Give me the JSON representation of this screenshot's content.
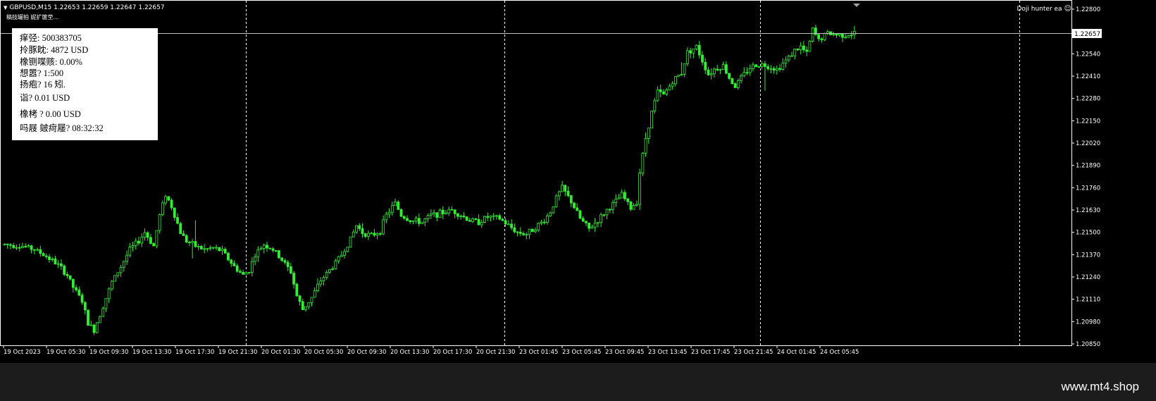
{
  "chart_header": {
    "symbol_line": "GBPUSD,M15  1.22653 1.22659 1.22647 1.22657",
    "sub_line": "稿技罐拍 妮扩箧茔...",
    "ea_name": "Doji hunter ea",
    "collapse_icon": "triangle-down",
    "smiley_icon": "smiley-face"
  },
  "info_panel": {
    "account": "痒弪: 500383705",
    "balance": "拎豚眈: 4872 USD",
    "drawdown": "橡铡喋赅: 0.00%",
    "leverage": "想嚣? 1:500",
    "spread": "扬疱? 16 矧.",
    "lot": "诣? 0.01 USD",
    "profit": "橡栲    ? 0.00 USD",
    "time": "吗屐     皴疴屦? 08:32:32"
  },
  "current_price": "1.22657",
  "watermark": "www.mt4.shop",
  "colors": {
    "candle": "#33ee33",
    "background": "#000000",
    "grid": "#ffffff"
  },
  "chart_data": {
    "type": "candlestick",
    "symbol": "GBPUSD",
    "timeframe": "M15",
    "ylim": [
      1.2085,
      1.2285
    ],
    "y_ticks": [
      "1.22800",
      "1.22670",
      "1.22540",
      "1.22410",
      "1.22280",
      "1.22150",
      "1.22020",
      "1.21890",
      "1.21760",
      "1.21630",
      "1.21500",
      "1.21370",
      "1.21240",
      "1.21110",
      "1.20980",
      "1.20850"
    ],
    "x_ticks": [
      "19 Oct 2023",
      "19 Oct 05:30",
      "19 Oct 09:30",
      "19 Oct 13:30",
      "19 Oct 17:30",
      "19 Oct 21:30",
      "20 Oct 01:30",
      "20 Oct 05:30",
      "20 Oct 09:30",
      "20 Oct 13:30",
      "20 Oct 17:30",
      "20 Oct 21:30",
      "23 Oct 01:45",
      "23 Oct 05:45",
      "23 Oct 09:45",
      "23 Oct 13:45",
      "23 Oct 17:45",
      "23 Oct 21:45",
      "24 Oct 01:45",
      "24 Oct 05:45"
    ],
    "close_path": [
      [
        0,
        1.2143
      ],
      [
        6,
        1.2142
      ],
      [
        10,
        1.214
      ],
      [
        14,
        1.2136
      ],
      [
        18,
        1.2131
      ],
      [
        21,
        1.2125
      ],
      [
        23,
        1.2118
      ],
      [
        26,
        1.211
      ],
      [
        28,
        1.2097
      ],
      [
        30,
        1.2093
      ],
      [
        33,
        1.2107
      ],
      [
        36,
        1.2121
      ],
      [
        39,
        1.213
      ],
      [
        42,
        1.214
      ],
      [
        45,
        1.2145
      ],
      [
        47,
        1.215
      ],
      [
        50,
        1.2142
      ],
      [
        52,
        1.216
      ],
      [
        54,
        1.2172
      ],
      [
        56,
        1.2165
      ],
      [
        59,
        1.215
      ],
      [
        61,
        1.2145
      ],
      [
        64,
        1.2142
      ],
      [
        67,
        1.214
      ],
      [
        70,
        1.2141
      ],
      [
        73,
        1.2139
      ],
      [
        77,
        1.213
      ],
      [
        80,
        1.2125
      ],
      [
        82,
        1.2128
      ],
      [
        84,
        1.2137
      ],
      [
        87,
        1.2143
      ],
      [
        90,
        1.214
      ],
      [
        93,
        1.2134
      ],
      [
        96,
        1.2127
      ],
      [
        98,
        1.2113
      ],
      [
        100,
        1.2105
      ],
      [
        103,
        1.2112
      ],
      [
        106,
        1.2122
      ],
      [
        110,
        1.213
      ],
      [
        113,
        1.2137
      ],
      [
        116,
        1.2146
      ],
      [
        118,
        1.2154
      ],
      [
        120,
        1.215
      ],
      [
        123,
        1.2148
      ],
      [
        126,
        1.2151
      ],
      [
        128,
        1.216
      ],
      [
        131,
        1.2167
      ],
      [
        133,
        1.216
      ],
      [
        136,
        1.2157
      ],
      [
        140,
        1.2156
      ],
      [
        143,
        1.216
      ],
      [
        146,
        1.2161
      ],
      [
        150,
        1.2163
      ],
      [
        153,
        1.216
      ],
      [
        156,
        1.2157
      ],
      [
        159,
        1.2156
      ],
      [
        162,
        1.2159
      ],
      [
        166,
        1.2158
      ],
      [
        169,
        1.2154
      ],
      [
        172,
        1.215
      ],
      [
        175,
        1.2149
      ],
      [
        178,
        1.2153
      ],
      [
        181,
        1.2157
      ],
      [
        183,
        1.2162
      ],
      [
        185,
        1.217
      ],
      [
        187,
        1.2176
      ],
      [
        190,
        1.2168
      ],
      [
        193,
        1.2158
      ],
      [
        196,
        1.2152
      ],
      [
        199,
        1.2157
      ],
      [
        202,
        1.2163
      ],
      [
        205,
        1.2168
      ],
      [
        207,
        1.2172
      ],
      [
        210,
        1.2164
      ],
      [
        212,
        1.2168
      ],
      [
        213,
        1.2185
      ],
      [
        215,
        1.2205
      ],
      [
        217,
        1.222
      ],
      [
        219,
        1.2232
      ],
      [
        221,
        1.223
      ],
      [
        224,
        1.2238
      ],
      [
        227,
        1.2243
      ],
      [
        229,
        1.2255
      ],
      [
        232,
        1.2258
      ],
      [
        234,
        1.225
      ],
      [
        236,
        1.2242
      ],
      [
        238,
        1.2245
      ],
      [
        241,
        1.2247
      ],
      [
        243,
        1.224
      ],
      [
        245,
        1.2235
      ],
      [
        247,
        1.224
      ],
      [
        250,
        1.2246
      ],
      [
        253,
        1.2248
      ],
      [
        256,
        1.2247
      ],
      [
        259,
        1.2245
      ],
      [
        262,
        1.225
      ],
      [
        265,
        1.2256
      ],
      [
        267,
        1.2258
      ],
      [
        269,
        1.2254
      ],
      [
        271,
        1.2268
      ],
      [
        273,
        1.2262
      ],
      [
        276,
        1.2266
      ],
      [
        279,
        1.2265
      ],
      [
        282,
        1.2265
      ],
      [
        285,
        1.2266
      ]
    ],
    "series": [
      {
        "name": "GBPUSD,M15",
        "n_bars": 286
      }
    ]
  }
}
